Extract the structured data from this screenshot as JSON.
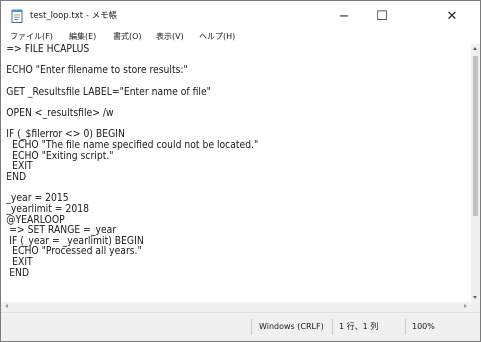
{
  "window": {
    "title": "test_loop.txt - メモ帳",
    "minimize_label": "−",
    "maximize_label": "☐",
    "close_label": "✕"
  },
  "menu": {
    "items": [
      {
        "label": "ファイル(F)"
      },
      {
        "label": "編集(E)"
      },
      {
        "label": "書式(O)"
      },
      {
        "label": "表示(V)"
      },
      {
        "label": "ヘルプ(H)"
      }
    ]
  },
  "editor": {
    "content": "=> FILE HCAPLUS\n\nECHO \"Enter filename to store results:\"\n\nGET _Resultsfile LABEL=\"Enter name of file\"\n\nOPEN <_resultsfile> /w\n\nIF (_$filerror <> 0) BEGIN\n  ECHO \"The file name specified could not be located.\"\n  ECHO \"Exiting script.\"\n  EXIT\nEND\n\n_year = 2015\n_yearlimit = 2018\n@YEARLOOP\n => SET RANGE =_year\n IF (_year = _yearlimit) BEGIN\n  ECHO \"Processed all years.\"\n  EXIT\n END"
  },
  "status": {
    "encoding": "Windows (CRLF)",
    "position": "1 行、1 列",
    "zoom": "100%"
  },
  "icons": {
    "app": "notepad-icon",
    "minimize": "minimize-icon",
    "maximize": "maximize-icon",
    "close": "close-icon"
  }
}
